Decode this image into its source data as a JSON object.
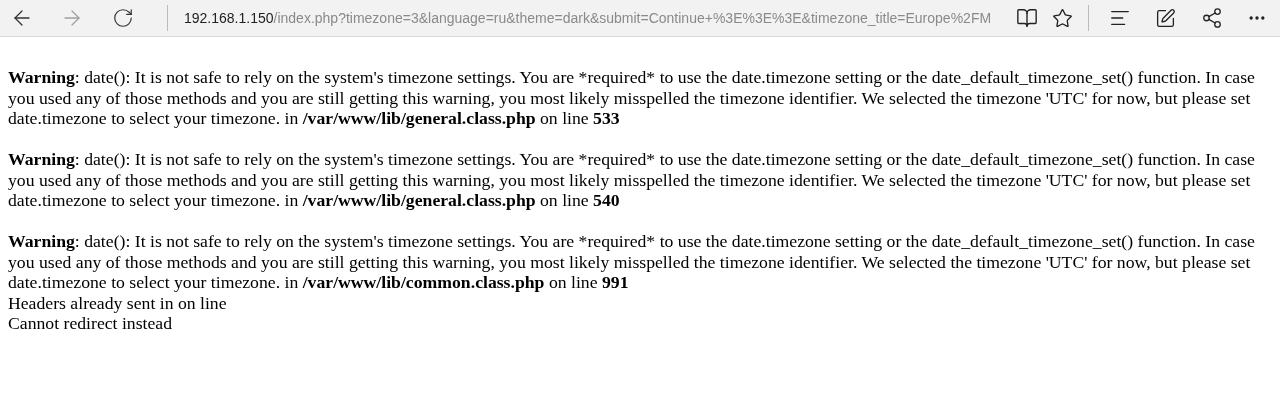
{
  "toolbar": {
    "back": {
      "disabled": false
    },
    "forward": {
      "disabled": true
    },
    "address": {
      "host": "192.168.1.150",
      "path": "/index.php?timezone=3&language=ru&theme=dark&submit=Continue+%3E%3E%3E&timezone_title=Europe%2FM"
    }
  },
  "warnings": [
    {
      "label": "Warning",
      "message": ": date(): It is not safe to rely on the system's timezone settings. You are *required* to use the date.timezone setting or the date_default_timezone_set() function. In case you used any of those methods and you are still getting this warning, you most likely misspelled the timezone identifier. We selected the timezone 'UTC' for now, but please set date.timezone to select your timezone. in",
      "file": "/var/www/lib/general.class.php",
      "line_text": "on line",
      "line": "533"
    },
    {
      "label": "Warning",
      "message": ": date(): It is not safe to rely on the system's timezone settings. You are *required* to use the date.timezone setting or the date_default_timezone_set() function. In case you used any of those methods and you are still getting this warning, you most likely misspelled the timezone identifier. We selected the timezone 'UTC' for now, but please set date.timezone to select your timezone. in",
      "file": "/var/www/lib/general.class.php",
      "line_text": "on line",
      "line": "540"
    },
    {
      "label": "Warning",
      "message": ": date(): It is not safe to rely on the system's timezone settings. You are *required* to use the date.timezone setting or the date_default_timezone_set() function. In case you used any of those methods and you are still getting this warning, you most likely misspelled the timezone identifier. We selected the timezone 'UTC' for now, but please set date.timezone to select your timezone. in",
      "file": "/var/www/lib/common.class.php",
      "line_text": "on line",
      "line": "991"
    }
  ],
  "lines": [
    "Headers already sent in on line",
    "Cannot redirect instead"
  ]
}
